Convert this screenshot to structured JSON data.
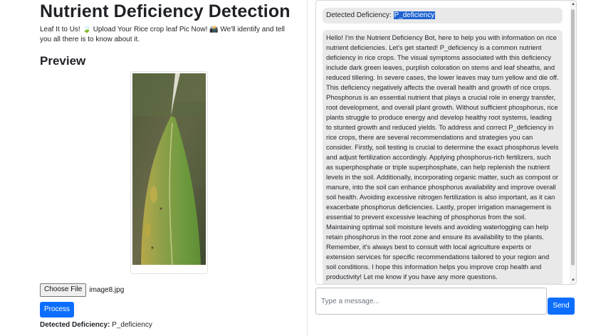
{
  "header": {
    "title": "Nutrient Deficiency Detection",
    "subtitle": "Leaf It to Us! 🍃 Upload Your Rice crop leaf Pic Now! 📸 We'll identify and tell you all there is to know about it."
  },
  "preview": {
    "heading": "Preview",
    "image_description": "rice-leaf-photo"
  },
  "upload": {
    "choose_label": "Choose File",
    "file_name": "image8.jpg",
    "process_label": "Process"
  },
  "result": {
    "label": "Detected Deficiency:",
    "value": "P_deficiency"
  },
  "chat": {
    "messages": [
      {
        "prefix": "Detected Deficiency: ",
        "highlight": "P_deficiency"
      },
      {
        "text": "Hello! I'm the Nutrient Deficiency Bot, here to help you with information on rice nutrient deficiencies. Let's get started! P_deficiency is a common nutrient deficiency in rice crops. The visual symptoms associated with this deficiency include dark green leaves, purplish coloration on stems and leaf sheaths, and reduced tillering. In severe cases, the lower leaves may turn yellow and die off. This deficiency negatively affects the overall health and growth of rice crops. Phosphorus is an essential nutrient that plays a crucial role in energy transfer, root development, and overall plant growth. Without sufficient phosphorus, rice plants struggle to produce energy and develop healthy root systems, leading to stunted growth and reduced yields. To address and correct P_deficiency in rice crops, there are several recommendations and strategies you can consider. Firstly, soil testing is crucial to determine the exact phosphorus levels and adjust fertilization accordingly. Applying phosphorus-rich fertilizers, such as superphosphate or triple superphosphate, can help replenish the nutrient levels in the soil. Additionally, incorporating organic matter, such as compost or manure, into the soil can enhance phosphorus availability and improve overall soil health. Avoiding excessive nitrogen fertilization is also important, as it can exacerbate phosphorus deficiencies. Lastly, proper irrigation management is essential to prevent excessive leaching of phosphorus from the soil. Maintaining optimal soil moisture levels and avoiding waterlogging can help retain phosphorus in the root zone and ensure its availability to the plants. Remember, it's always best to consult with local agriculture experts or extension services for specific recommendations tailored to your region and soil conditions. I hope this information helps you improve crop health and productivity! Let me know if you have any more questions."
      }
    ],
    "input_placeholder": "Type a message...",
    "send_label": "Send"
  },
  "colors": {
    "accent": "#0d6efd",
    "bubble": "#e9e9ea",
    "highlight": "#1e62d0"
  }
}
